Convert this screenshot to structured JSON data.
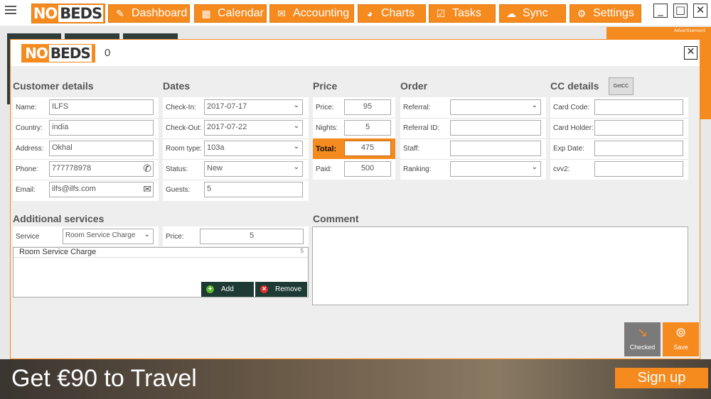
{
  "app": {
    "logo_no": "NO",
    "logo_beds": "BEDS"
  },
  "nav": [
    {
      "label": "Dashboard",
      "icon": "✎"
    },
    {
      "label": "Calendar",
      "icon": "▦"
    },
    {
      "label": "Accounting",
      "icon": "✉"
    },
    {
      "label": "Charts",
      "icon": "◕"
    },
    {
      "label": "Tasks",
      "icon": "☑"
    },
    {
      "label": "Sync",
      "icon": "☁"
    },
    {
      "label": "Settings",
      "icon": "⚙"
    }
  ],
  "window": {
    "minimize": "_",
    "maximize": "□",
    "close": "✕"
  },
  "ad": {
    "label": "Advertisement",
    "text": "Get €90 to Travel",
    "cta": "Sign up"
  },
  "modal": {
    "booking_number": "0",
    "close": "✕",
    "customer": {
      "title": "Customer details",
      "name_label": "Name:",
      "name": "ILFS",
      "country_label": "Country:",
      "country": "india",
      "address_label": "Address:",
      "address": "Okhal",
      "phone_label": "Phone:",
      "phone": "777778978",
      "email_label": "Email:",
      "email": "ilfs@ilfs.com"
    },
    "dates": {
      "title": "Dates",
      "checkin_label": "Check-In:",
      "checkin": "2017-07-17",
      "checkout_label": "Check-Out:",
      "checkout": "2017-07-22",
      "roomtype_label": "Room type:",
      "roomtype": "103a",
      "status_label": "Status:",
      "status": "New",
      "guests_label": "Guests:",
      "guests": "5"
    },
    "price": {
      "title": "Price",
      "price_label": "Price:",
      "price": "95",
      "nights_label": "Nights:",
      "nights": "5",
      "total_label": "Total:",
      "total": "475",
      "paid_label": "Paid:",
      "paid": "500"
    },
    "order": {
      "title": "Order",
      "referral_label": "Referral:",
      "referral": "",
      "referral_id_label": "Referral ID:",
      "referral_id": "",
      "staff_label": "Staff:",
      "staff": "",
      "ranking_label": "Ranking:",
      "ranking": ""
    },
    "cc": {
      "title": "CC details",
      "getcc": "GetCC",
      "code_label": "Card Code:",
      "holder_label": "Card Holder:",
      "exp_label": "Exp Date:",
      "cvv_label": "cvv2:"
    },
    "services": {
      "title": "Additional services",
      "service_label": "Service",
      "service": "Room Service Charge",
      "price_label": "Price:",
      "price": "5",
      "items": [
        {
          "name": "Room Service Charge",
          "price": "5"
        }
      ],
      "add": "Add",
      "remove": "Remove"
    },
    "comment": {
      "title": "Comment"
    },
    "actions": {
      "checked": "Checked",
      "save": "Save"
    }
  }
}
